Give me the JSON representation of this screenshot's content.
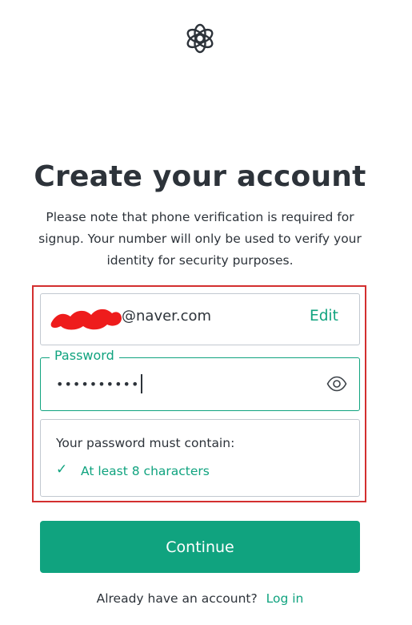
{
  "logo": {
    "icon": "openai-logo-icon"
  },
  "heading": {
    "title": "Create your account",
    "subtitle": "Please note that phone verification is required for signup. Your number will only be used to verify your identity for security purposes."
  },
  "email": {
    "value": "@naver.com",
    "edit_label": "Edit"
  },
  "password": {
    "label": "Password",
    "value": "••••••••••",
    "toggle_icon": "eye-icon"
  },
  "requirements": {
    "title": "Your password must contain:",
    "items": [
      {
        "check": "✓",
        "label": "At least 8 characters"
      }
    ]
  },
  "actions": {
    "continue_label": "Continue",
    "login_prompt": "Already have an account?",
    "login_link": "Log in"
  },
  "colors": {
    "accent": "#10a37f",
    "text": "#2d333a",
    "border": "#c2c8d0",
    "highlight": "#d32f2f",
    "redaction": "#ee1c1c"
  }
}
